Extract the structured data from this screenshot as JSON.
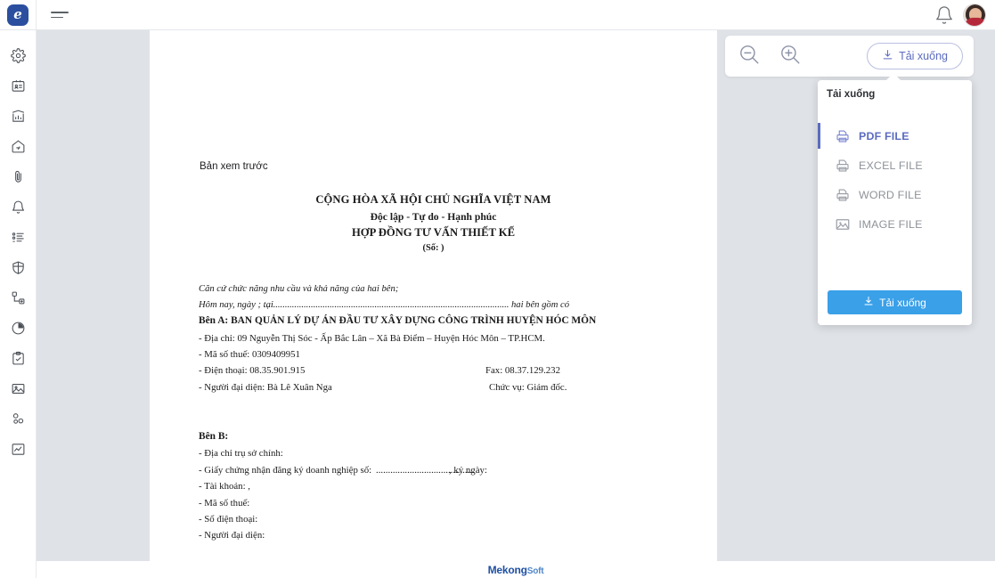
{
  "app": {
    "logo_letter": "e",
    "brand_name": "Mekong",
    "brand_suffix": "Soft"
  },
  "topbar": {
    "menu_icon": "hamburger-icon",
    "notification_icon": "bell-icon",
    "avatar": "user-avatar"
  },
  "sidebar": {
    "items": [
      {
        "name": "settings",
        "icon": "gear-icon"
      },
      {
        "name": "id-card",
        "icon": "id-card-icon"
      },
      {
        "name": "analytics",
        "icon": "bar-chart-icon"
      },
      {
        "name": "home",
        "icon": "home-icon"
      },
      {
        "name": "attachments",
        "icon": "paperclip-icon"
      },
      {
        "name": "notifications",
        "icon": "bell-icon"
      },
      {
        "name": "tasks",
        "icon": "checklist-icon"
      },
      {
        "name": "security",
        "icon": "shield-icon"
      },
      {
        "name": "workflow",
        "icon": "flow-add-icon"
      },
      {
        "name": "time",
        "icon": "pie-clock-icon"
      },
      {
        "name": "clipboard",
        "icon": "clipboard-check-icon"
      },
      {
        "name": "gallery",
        "icon": "image-icon"
      },
      {
        "name": "nodes",
        "icon": "nodes-icon"
      },
      {
        "name": "reports",
        "icon": "chart-image-icon"
      }
    ]
  },
  "toolbar": {
    "zoom_out_icon": "zoom-out-icon",
    "zoom_in_icon": "zoom-in-icon",
    "download_label": "Tải xuống",
    "download_icon": "download-icon"
  },
  "dropdown": {
    "title": "Tải xuống",
    "items": [
      {
        "label": "PDF FILE",
        "icon": "pdf-file-icon",
        "active": true
      },
      {
        "label": "EXCEL FILE",
        "icon": "excel-file-icon",
        "active": false
      },
      {
        "label": "WORD FILE",
        "icon": "word-file-icon",
        "active": false
      },
      {
        "label": "IMAGE FILE",
        "icon": "image-file-icon",
        "active": false
      }
    ],
    "button_label": "Tải xuống",
    "button_icon": "download-icon",
    "accent_color": "#5c6bc0",
    "button_color": "#3aa0e8"
  },
  "document": {
    "preview_label": "Bản xem trước",
    "nation": "CỘNG HÒA XÃ HỘI CHỦ NGHĨA VIỆT NAM",
    "motto": "Độc lập - Tự do - Hạnh phúc",
    "title": "HỢP ĐỒNG TƯ VẤN THIẾT KẾ",
    "number": "(Số: )",
    "preamble_1": "Căn cứ chức năng nhu cầu và khả năng của hai bên;",
    "preamble_2_left": "Hôm nay, ngày ; tại",
    "preamble_2_dots": "........................................................................................................",
    "preamble_2_right": "hai bên gồm có",
    "party_a_heading": "Bên A: BAN QUẢN LÝ DỰ ÁN ĐẦU TƯ XÂY DỰNG CÔNG TRÌNH HUYỆN HÓC MÔN",
    "party_a_address": "- Địa chỉ: 09 Nguyễn Thị Sóc - Ấp Bắc Lân – Xã Bà Điểm – Huyện Hóc Môn – TP.HCM.",
    "party_a_tax": "-  Mã số thuế: 0309409951",
    "party_a_phone": "- Điện thoại: 08.35.901.915",
    "party_a_fax": "Fax: 08.37.129.232",
    "party_a_rep": "- Người đại diện: Bà Lê Xuân Nga",
    "party_a_role": "Chức vụ: Giám đốc.",
    "party_b_heading": "Bên B:",
    "party_b_address": "- Địa chỉ trụ sở chính:",
    "party_b_license_left": "- Giấy chứng nhận đăng ký doanh nghiệp số:",
    "party_b_license_dots": ".........................................",
    "party_b_license_right": ", ký ngày:",
    "party_b_account": "- Tài khoản: ,",
    "party_b_tax": "- Mã số thuế:",
    "party_b_phone": "- Số điện thoại:",
    "party_b_rep": "- Người đại diện:"
  }
}
